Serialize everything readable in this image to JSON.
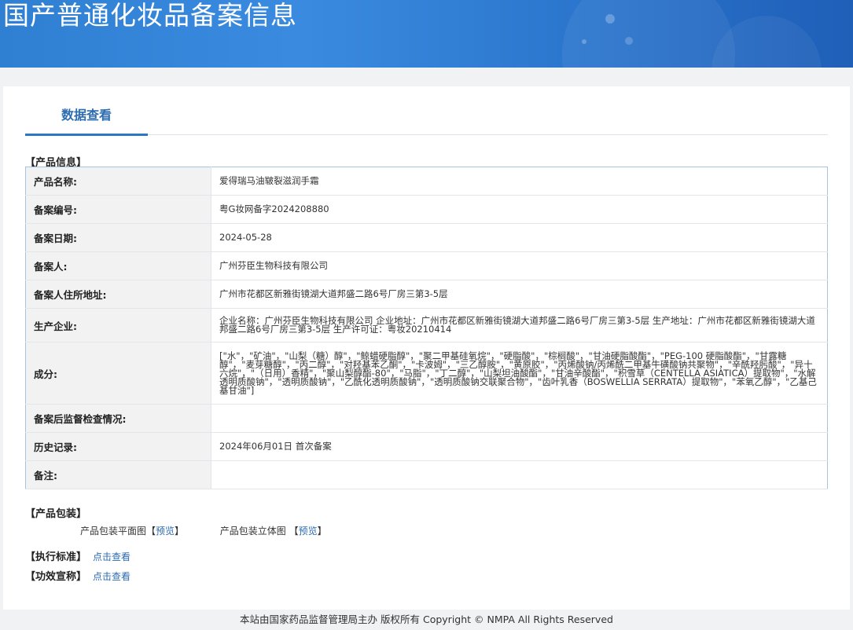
{
  "header": {
    "title": "国产普通化妆品备案信息"
  },
  "tabs": [
    {
      "label": "数据查看"
    }
  ],
  "product_info": {
    "section_title": "【产品信息】",
    "rows": [
      {
        "key": "产品名称:",
        "value": "爱得瑞马油皲裂滋润手霜"
      },
      {
        "key": "备案编号:",
        "value": "粤G妆网备字2024208880"
      },
      {
        "key": "备案日期:",
        "value": "2024-05-28"
      },
      {
        "key": "备案人:",
        "value": "广州芬臣生物科技有限公司"
      },
      {
        "key": "备案人住所地址:",
        "value": "广州市花都区新雅街镜湖大道邦盛二路6号厂房三第3-5层"
      },
      {
        "key": "生产企业:",
        "value": "企业名称：广州芬臣生物科技有限公司 企业地址：广州市花都区新雅街镜湖大道邦盛二路6号厂房三第3-5层 生产地址：广州市花都区新雅街镜湖大道邦盛二路6号厂房三第3-5层 生产许可证：粤妆20210414"
      },
      {
        "key": "成分:",
        "value": "[\"水\"，\"矿油\"，\"山梨（糖）醇\"，\"鲸蜡硬脂醇\"，\"聚二甲基硅氧烷\"，\"硬脂酸\"，\"棕榈酸\"，\"甘油硬脂酸酯\"，\"PEG-100 硬脂酸酯\"，\"甘露糖醇\"，\"麦芽糖醇\"，\"丙二醇\"，\"对羟基苯乙酮\"，\"卡波姆\"，\"三乙醇胺\"，\"黄原胶\"，\"丙烯酸钠/丙烯酰二甲基牛磺酸钠共聚物\"，\"辛酰羟肟酸\"，\"异十六烷\"，\"（日用）香精\"，\"聚山梨醇酯-80\"，\"马脂\"，\"丁二醇\"，\"山梨坦油酸酯\"，\"甘油辛酸酯\"，\"积雪草（CENTELLA ASIATICA）提取物\"，\"水解透明质酸钠\"，\"透明质酸钠\"，\"乙酰化透明质酸钠\"，\"透明质酸钠交联聚合物\"，\"齿叶乳香（BOSWELLIA SERRATA）提取物\"，\"苯氧乙醇\"，\"乙基己基甘油\"]"
      },
      {
        "key": "备案后监督检查情况:",
        "value": ""
      },
      {
        "key": "历史记录:",
        "value": "2024年06月01日 首次备案"
      },
      {
        "key": "备注:",
        "value": ""
      }
    ]
  },
  "packaging": {
    "section_title": "【产品包装】",
    "flat_label": "产品包装平面图",
    "solid_label": "产品包装立体图",
    "bracket_open": "【",
    "bracket_close": "】",
    "preview_label": "预览"
  },
  "standard": {
    "label": "【执行标准】",
    "link": "点击查看"
  },
  "claims": {
    "label": "【功效宣称】",
    "link": "点击查看"
  },
  "footer": {
    "text": "本站由国家药品监督管理局主办 版权所有 Copyright © NMPA All Rights Reserved"
  }
}
